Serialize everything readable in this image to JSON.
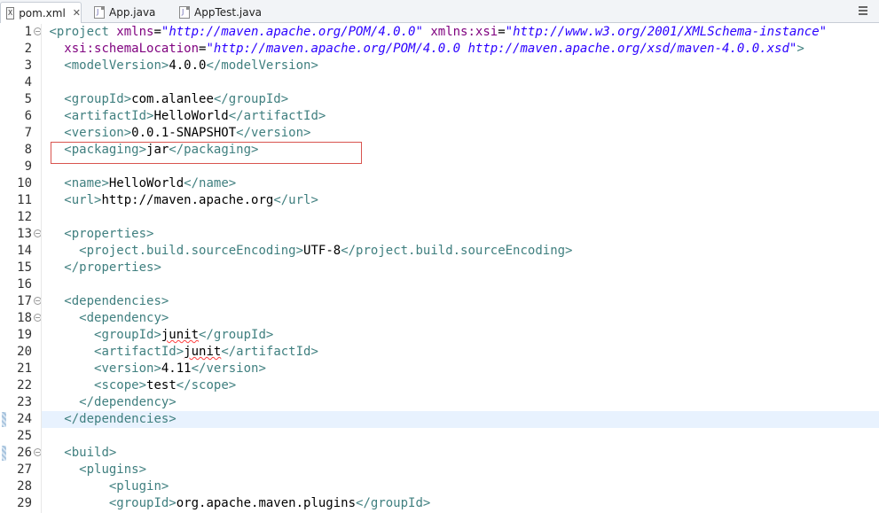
{
  "tabs": [
    {
      "label": "pom.xml",
      "icon": "xml-file-icon",
      "active": true,
      "closable": true
    },
    {
      "label": "App.java",
      "icon": "java-file-icon",
      "active": false,
      "closable": false
    },
    {
      "label": "AppTest.java",
      "icon": "java-file-icon",
      "active": false,
      "closable": false
    }
  ],
  "close_glyph": "✕",
  "editor": {
    "current_line": 24,
    "highlighted_line": 8,
    "marked_lines": [
      24,
      26
    ],
    "fold_lines": [
      1,
      13,
      17,
      18,
      26
    ],
    "lines": [
      {
        "n": "1",
        "tokens": [
          [
            "tag",
            "<project "
          ],
          [
            "attr",
            "xmlns"
          ],
          [
            "txt",
            "="
          ],
          [
            "val",
            "\"http://maven.apache.org/POM/4.0.0\""
          ],
          [
            "txt",
            " "
          ],
          [
            "attr",
            "xmlns:xsi"
          ],
          [
            "txt",
            "="
          ],
          [
            "val",
            "\"http://www.w3.org/2001/XMLSchema-instance\""
          ]
        ]
      },
      {
        "n": "2",
        "tokens": [
          [
            "txt",
            "  "
          ],
          [
            "attr",
            "xsi:schemaLocation"
          ],
          [
            "txt",
            "="
          ],
          [
            "val",
            "\"http://maven.apache.org/POM/4.0.0 http://maven.apache.org/xsd/maven-4.0.0.xsd\""
          ],
          [
            "tag",
            ">"
          ]
        ]
      },
      {
        "n": "3",
        "tokens": [
          [
            "txt",
            "  "
          ],
          [
            "tag",
            "<modelVersion>"
          ],
          [
            "txt",
            "4.0.0"
          ],
          [
            "tag",
            "</modelVersion>"
          ]
        ]
      },
      {
        "n": "4",
        "tokens": []
      },
      {
        "n": "5",
        "tokens": [
          [
            "txt",
            "  "
          ],
          [
            "tag",
            "<groupId>"
          ],
          [
            "txt",
            "com.alanlee"
          ],
          [
            "tag",
            "</groupId>"
          ]
        ]
      },
      {
        "n": "6",
        "tokens": [
          [
            "txt",
            "  "
          ],
          [
            "tag",
            "<artifactId>"
          ],
          [
            "txt",
            "HelloWorld"
          ],
          [
            "tag",
            "</artifactId>"
          ]
        ]
      },
      {
        "n": "7",
        "tokens": [
          [
            "txt",
            "  "
          ],
          [
            "tag",
            "<version>"
          ],
          [
            "txt",
            "0.0.1-SNAPSHOT"
          ],
          [
            "tag",
            "</version>"
          ]
        ]
      },
      {
        "n": "8",
        "tokens": [
          [
            "txt",
            "  "
          ],
          [
            "tag",
            "<packaging>"
          ],
          [
            "txt",
            "jar"
          ],
          [
            "tag",
            "</packaging>"
          ]
        ]
      },
      {
        "n": "9",
        "tokens": []
      },
      {
        "n": "10",
        "tokens": [
          [
            "txt",
            "  "
          ],
          [
            "tag",
            "<name>"
          ],
          [
            "txt",
            "HelloWorld"
          ],
          [
            "tag",
            "</name>"
          ]
        ]
      },
      {
        "n": "11",
        "tokens": [
          [
            "txt",
            "  "
          ],
          [
            "tag",
            "<url>"
          ],
          [
            "txt",
            "http://maven.apache.org"
          ],
          [
            "tag",
            "</url>"
          ]
        ]
      },
      {
        "n": "12",
        "tokens": []
      },
      {
        "n": "13",
        "tokens": [
          [
            "txt",
            "  "
          ],
          [
            "tag",
            "<properties>"
          ]
        ]
      },
      {
        "n": "14",
        "tokens": [
          [
            "txt",
            "    "
          ],
          [
            "tag",
            "<project.build.sourceEncoding>"
          ],
          [
            "txt",
            "UTF-8"
          ],
          [
            "tag",
            "</project.build.sourceEncoding>"
          ]
        ]
      },
      {
        "n": "15",
        "tokens": [
          [
            "txt",
            "  "
          ],
          [
            "tag",
            "</properties>"
          ]
        ]
      },
      {
        "n": "16",
        "tokens": []
      },
      {
        "n": "17",
        "tokens": [
          [
            "txt",
            "  "
          ],
          [
            "tag",
            "<dependencies>"
          ]
        ]
      },
      {
        "n": "18",
        "tokens": [
          [
            "txt",
            "    "
          ],
          [
            "tag",
            "<dependency>"
          ]
        ]
      },
      {
        "n": "19",
        "tokens": [
          [
            "txt",
            "      "
          ],
          [
            "tag",
            "<groupId>"
          ],
          [
            "err",
            "junit"
          ],
          [
            "tag",
            "</groupId>"
          ]
        ]
      },
      {
        "n": "20",
        "tokens": [
          [
            "txt",
            "      "
          ],
          [
            "tag",
            "<artifactId>"
          ],
          [
            "err",
            "junit"
          ],
          [
            "tag",
            "</artifactId>"
          ]
        ]
      },
      {
        "n": "21",
        "tokens": [
          [
            "txt",
            "      "
          ],
          [
            "tag",
            "<version>"
          ],
          [
            "txt",
            "4.11"
          ],
          [
            "tag",
            "</version>"
          ]
        ]
      },
      {
        "n": "22",
        "tokens": [
          [
            "txt",
            "      "
          ],
          [
            "tag",
            "<scope>"
          ],
          [
            "txt",
            "test"
          ],
          [
            "tag",
            "</scope>"
          ]
        ]
      },
      {
        "n": "23",
        "tokens": [
          [
            "txt",
            "    "
          ],
          [
            "tag",
            "</dependency>"
          ]
        ]
      },
      {
        "n": "24",
        "tokens": [
          [
            "txt",
            "  "
          ],
          [
            "tag",
            "</dependencies>"
          ]
        ]
      },
      {
        "n": "25",
        "tokens": []
      },
      {
        "n": "26",
        "tokens": [
          [
            "txt",
            "  "
          ],
          [
            "tag",
            "<build>"
          ]
        ]
      },
      {
        "n": "27",
        "tokens": [
          [
            "txt",
            "    "
          ],
          [
            "tag",
            "<plugins>"
          ]
        ]
      },
      {
        "n": "28",
        "tokens": [
          [
            "txt",
            "        "
          ],
          [
            "tag",
            "<plugin>"
          ]
        ]
      },
      {
        "n": "29",
        "tokens": [
          [
            "txt",
            "        "
          ],
          [
            "tag",
            "<groupId>"
          ],
          [
            "txt",
            "org.apache.maven.plugins"
          ],
          [
            "tag",
            "</groupId>"
          ]
        ]
      }
    ]
  },
  "colors": {
    "tag": "#3f7f7f",
    "attribute": "#7f007f",
    "value": "#2a00ff",
    "text": "#000000",
    "current_line": "#e8f2fe",
    "highlight_box": "#d9544f"
  }
}
